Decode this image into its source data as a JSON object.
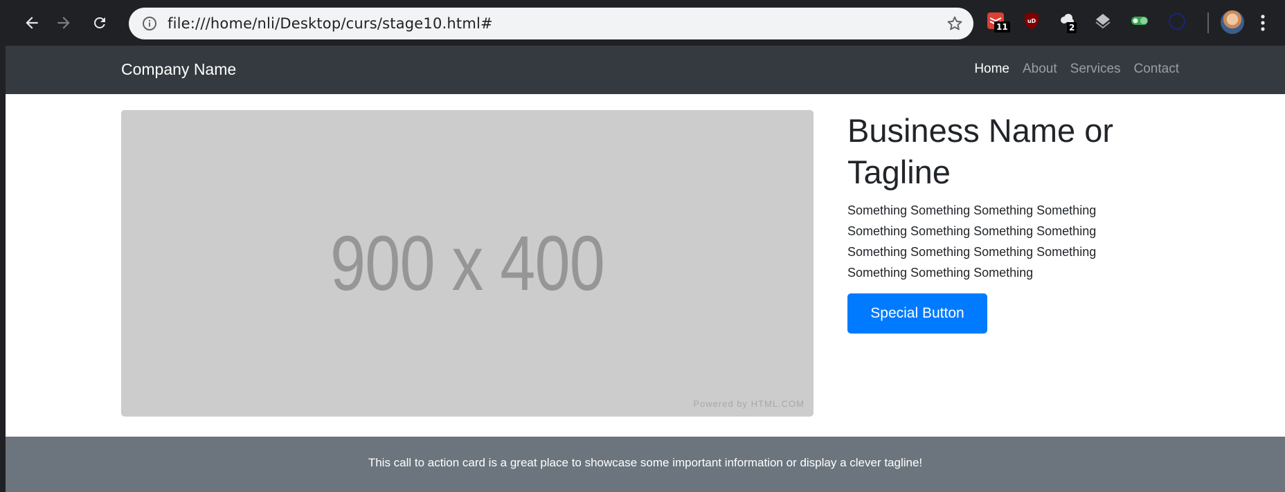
{
  "browser": {
    "url": "file:///home/nli/Desktop/curs/stage10.html#",
    "extensions": [
      {
        "name": "todoist-extension",
        "badge": "11"
      },
      {
        "name": "ublock-extension",
        "badge": ""
      },
      {
        "name": "cloud-extension",
        "badge": "2"
      },
      {
        "name": "layers-extension",
        "badge": ""
      },
      {
        "name": "toggle-extension",
        "badge": ""
      },
      {
        "name": "circle-extension",
        "badge": ""
      }
    ]
  },
  "navbar": {
    "brand": "Company Name",
    "links": [
      "Home",
      "About",
      "Services",
      "Contact"
    ],
    "active": "Home"
  },
  "hero": {
    "image_label": "900 x 400",
    "image_credit": "Powered by HTML.COM",
    "title": "Business Name or Tagline",
    "body": "Something Something Something Something Something Something Something Something Something Something Something Something Something Something Something",
    "button_label": "Special Button"
  },
  "cta": {
    "text": "This call to action card is a great place to showcase some important information or display a clever tagline!"
  },
  "colors": {
    "navbar_bg": "#343a40",
    "button_bg": "#007bff",
    "cta_bg": "#6c757d",
    "placeholder_bg": "#cccccc"
  }
}
